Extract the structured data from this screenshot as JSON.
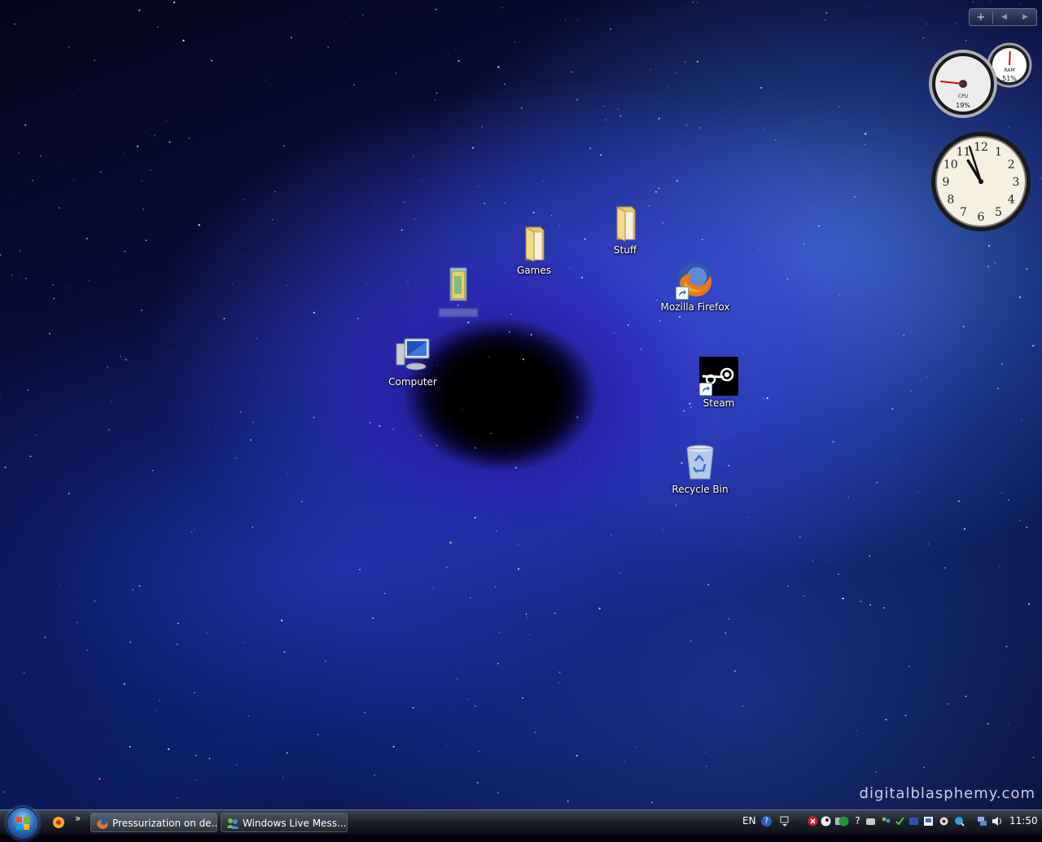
{
  "desktop": {
    "watermark": "digitalblasphemy.com",
    "icons": {
      "games": "Games",
      "stuff": "Stuff",
      "firefox": "Mozilla Firefox",
      "computer": "Computer",
      "steam": "Steam",
      "recycle_bin": "Recycle Bin"
    }
  },
  "gadgets": {
    "sidebar_add": "+",
    "sidebar_prev": "◀",
    "sidebar_next": "▶",
    "cpu_meter": {
      "cpu_label": "CPU",
      "cpu_percent": "19%",
      "ram_label": "RAM",
      "ram_percent": "51%",
      "cpu_value": 19,
      "ram_value": 51
    },
    "clock": {
      "numbers": [
        "12",
        "1",
        "2",
        "3",
        "4",
        "5",
        "6",
        "7",
        "8",
        "9",
        "10",
        "11"
      ],
      "hour": 10,
      "minute": 57
    }
  },
  "taskbar": {
    "quick_launch_more": "»",
    "tasks": [
      {
        "label": "Pressurization on de...",
        "icon": "firefox-icon"
      },
      {
        "label": "Windows Live Mess...",
        "icon": "messenger-icon"
      }
    ],
    "language": "EN",
    "tray_help": "?",
    "tray_help2": "?",
    "time": "11:50"
  },
  "colors": {
    "taskbar_top": "#3d4553",
    "taskbar_bottom": "#0c0f14",
    "nebula_blue": "#3c46e6"
  }
}
